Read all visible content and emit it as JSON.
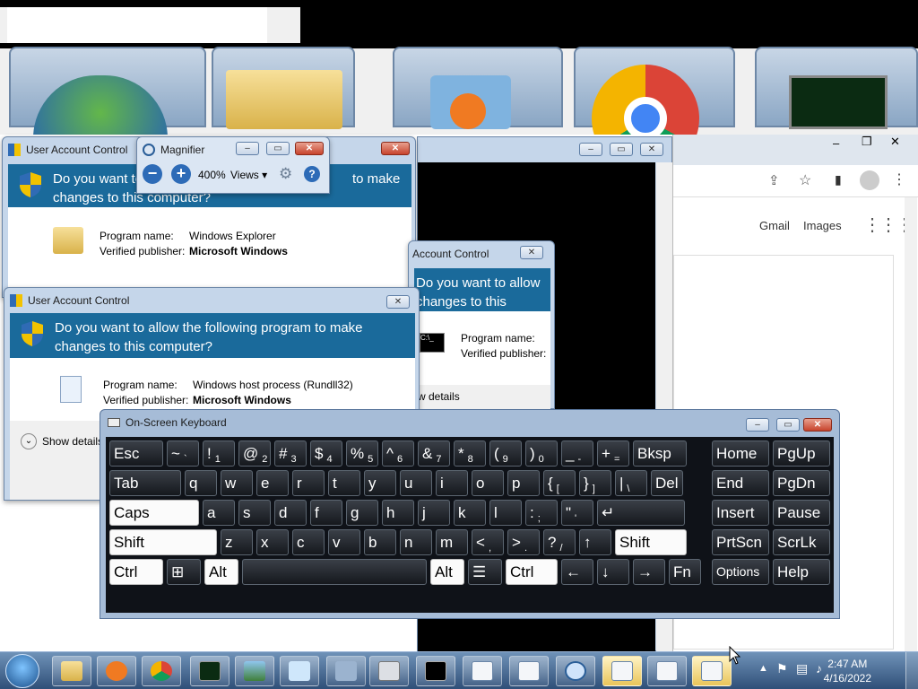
{
  "magnifier": {
    "title": "Magnifier",
    "zoom": "400%",
    "views_label": "Views"
  },
  "uac_windows": {
    "title": "User Account Control",
    "question": "Do you want to allow the following program to make changes to this computer?",
    "question_cut_top": "Do you want to",
    "question_cut_top_end": "to make",
    "question_cut_line2": "changes to this computer?",
    "explorer": {
      "program_label": "Program name:",
      "program_value": "Windows Explorer",
      "publisher_label": "Verified publisher:",
      "publisher_value": "Microsoft Windows"
    },
    "rundll": {
      "program_label": "Program name:",
      "program_value": "Windows host process (Rundll32)",
      "publisher_label": "Verified publisher:",
      "publisher_value": "Microsoft Windows",
      "show_details": "Show details"
    },
    "cmd": {
      "title_partial": "Account Control",
      "question_line1": "Do you want to allow",
      "question_line2": "changes to this compu",
      "program_label": "Program name:",
      "publisher_label": "Verified publisher:",
      "show_details_partial": "w details"
    }
  },
  "chrome": {
    "gmail": "Gmail",
    "images": "Images"
  },
  "osk": {
    "title": "On-Screen Keyboard",
    "rows": [
      [
        {
          "main": "Esc"
        },
        {
          "main": "~",
          "sub": "`"
        },
        {
          "main": "!",
          "sub": "1"
        },
        {
          "main": "@",
          "sub": "2"
        },
        {
          "main": "#",
          "sub": "3"
        },
        {
          "main": "$",
          "sub": "4"
        },
        {
          "main": "%",
          "sub": "5"
        },
        {
          "main": "^",
          "sub": "6"
        },
        {
          "main": "&",
          "sub": "7"
        },
        {
          "main": "*",
          "sub": "8"
        },
        {
          "main": "(",
          "sub": "9"
        },
        {
          "main": ")",
          "sub": "0"
        },
        {
          "main": "_",
          "sub": "-"
        },
        {
          "main": "+",
          "sub": "="
        },
        {
          "main": "Bksp"
        },
        {
          "main": "Home"
        },
        {
          "main": "PgUp"
        }
      ],
      [
        {
          "main": "Tab"
        },
        {
          "main": "q"
        },
        {
          "main": "w"
        },
        {
          "main": "e"
        },
        {
          "main": "r"
        },
        {
          "main": "t"
        },
        {
          "main": "y"
        },
        {
          "main": "u"
        },
        {
          "main": "i"
        },
        {
          "main": "o"
        },
        {
          "main": "p"
        },
        {
          "main": "{",
          "sub": "["
        },
        {
          "main": "}",
          "sub": "]"
        },
        {
          "main": "|",
          "sub": "\\"
        },
        {
          "main": "Del"
        },
        {
          "main": "End"
        },
        {
          "main": "PgDn"
        }
      ],
      [
        {
          "main": "Caps"
        },
        {
          "main": "a"
        },
        {
          "main": "s"
        },
        {
          "main": "d"
        },
        {
          "main": "f"
        },
        {
          "main": "g"
        },
        {
          "main": "h"
        },
        {
          "main": "j"
        },
        {
          "main": "k"
        },
        {
          "main": "l"
        },
        {
          "main": ":",
          "sub": ";"
        },
        {
          "main": "\"",
          "sub": "'"
        },
        {
          "main": "↵"
        },
        {
          "main": "Insert"
        },
        {
          "main": "Pause"
        }
      ],
      [
        {
          "main": "Shift"
        },
        {
          "main": "z"
        },
        {
          "main": "x"
        },
        {
          "main": "c"
        },
        {
          "main": "v"
        },
        {
          "main": "b"
        },
        {
          "main": "n"
        },
        {
          "main": "m"
        },
        {
          "main": "<",
          "sub": ","
        },
        {
          "main": ">",
          "sub": "."
        },
        {
          "main": "?",
          "sub": "/"
        },
        {
          "main": "↑"
        },
        {
          "main": "Shift"
        },
        {
          "main": "PrtScn"
        },
        {
          "main": "ScrLk"
        }
      ],
      [
        {
          "main": "Ctrl"
        },
        {
          "main": "⊞"
        },
        {
          "main": "Alt"
        },
        {
          "main": ""
        },
        {
          "main": "Alt"
        },
        {
          "main": "☰"
        },
        {
          "main": "Ctrl"
        },
        {
          "main": "←"
        },
        {
          "main": "↓"
        },
        {
          "main": "→"
        },
        {
          "main": "Fn"
        },
        {
          "main": "Options"
        },
        {
          "main": "Help"
        }
      ]
    ]
  },
  "taskbar": {
    "time": "2:47 AM",
    "date": "4/16/2022"
  }
}
